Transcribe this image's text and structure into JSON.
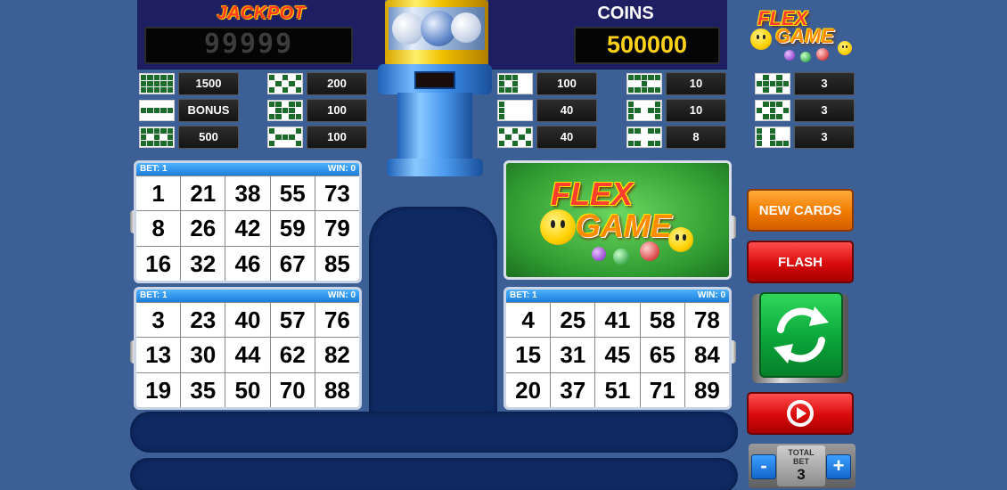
{
  "jackpot": {
    "label": "JACKPOT",
    "value": "99999"
  },
  "coins": {
    "label": "COINS",
    "value": "500000"
  },
  "logo": {
    "line1": "FLEX",
    "line2": "GAME"
  },
  "paytable": [
    {
      "value": "1500",
      "pattern": [
        1,
        1,
        1,
        1,
        1,
        1,
        1,
        1,
        1,
        1,
        1,
        1,
        1,
        1,
        1
      ]
    },
    {
      "value": "BONUS",
      "pattern": [
        0,
        0,
        0,
        0,
        0,
        1,
        1,
        1,
        1,
        1,
        0,
        0,
        0,
        0,
        0
      ]
    },
    {
      "value": "500",
      "pattern": [
        1,
        1,
        1,
        1,
        1,
        1,
        0,
        1,
        0,
        1,
        1,
        1,
        1,
        1,
        1
      ]
    },
    {
      "value": "200",
      "pattern": [
        1,
        0,
        1,
        0,
        1,
        0,
        1,
        0,
        1,
        0,
        1,
        0,
        1,
        0,
        1
      ]
    },
    {
      "value": "100",
      "pattern": [
        1,
        1,
        0,
        1,
        1,
        0,
        1,
        1,
        1,
        0,
        1,
        1,
        0,
        1,
        1
      ]
    },
    {
      "value": "100",
      "pattern": [
        1,
        0,
        0,
        0,
        1,
        0,
        1,
        1,
        1,
        0,
        1,
        0,
        0,
        0,
        1
      ]
    },
    {
      "value": "100",
      "pattern": [
        1,
        1,
        1,
        0,
        0,
        1,
        0,
        1,
        0,
        0,
        1,
        1,
        1,
        0,
        0
      ]
    },
    {
      "value": "40",
      "pattern": [
        1,
        0,
        0,
        0,
        0,
        1,
        0,
        0,
        0,
        0,
        1,
        0,
        0,
        0,
        0
      ]
    },
    {
      "value": "40",
      "pattern": [
        1,
        0,
        1,
        0,
        1,
        0,
        1,
        0,
        1,
        0,
        1,
        0,
        1,
        0,
        1
      ]
    },
    {
      "value": "10",
      "pattern": [
        1,
        1,
        1,
        1,
        1,
        0,
        0,
        1,
        0,
        0,
        1,
        1,
        1,
        1,
        1
      ]
    },
    {
      "value": "10",
      "pattern": [
        1,
        0,
        0,
        0,
        1,
        1,
        1,
        0,
        1,
        1,
        1,
        0,
        0,
        0,
        1
      ]
    },
    {
      "value": "8",
      "pattern": [
        1,
        1,
        0,
        1,
        1,
        0,
        0,
        0,
        0,
        0,
        1,
        1,
        0,
        1,
        1
      ]
    },
    {
      "value": "3",
      "pattern": [
        0,
        1,
        0,
        1,
        0,
        1,
        1,
        1,
        1,
        1,
        0,
        1,
        0,
        1,
        0
      ]
    },
    {
      "value": "3",
      "pattern": [
        0,
        1,
        1,
        1,
        0,
        1,
        0,
        1,
        0,
        1,
        0,
        1,
        1,
        1,
        0
      ]
    },
    {
      "value": "3",
      "pattern": [
        1,
        0,
        1,
        0,
        0,
        1,
        0,
        1,
        0,
        0,
        1,
        0,
        1,
        1,
        1
      ]
    }
  ],
  "cards": [
    {
      "bet": "BET: 1",
      "win": "WIN: 0",
      "numbers": [
        "1",
        "21",
        "38",
        "55",
        "73",
        "8",
        "26",
        "42",
        "59",
        "79",
        "16",
        "32",
        "46",
        "67",
        "85"
      ]
    },
    {
      "bet": "BET: 1",
      "win": "WIN: 0",
      "numbers": [
        "3",
        "23",
        "40",
        "57",
        "76",
        "13",
        "30",
        "44",
        "62",
        "82",
        "19",
        "35",
        "50",
        "70",
        "88"
      ]
    },
    {
      "bet": "BET: 1",
      "win": "WIN: 0",
      "numbers": [
        "4",
        "25",
        "41",
        "58",
        "78",
        "15",
        "31",
        "45",
        "65",
        "84",
        "20",
        "37",
        "51",
        "71",
        "89"
      ]
    }
  ],
  "buttons": {
    "new_cards": "NEW CARDS",
    "flash": "FLASH",
    "total_bet_label_1": "TOTAL",
    "total_bet_label_2": "BET",
    "total_bet_value": "3",
    "minus": "-",
    "plus": "+"
  },
  "colors": {
    "background": "#3c5f95",
    "pattern_on": "#1b6b2a",
    "card_header": "#1a7ed8",
    "new_cards": "#f07a00",
    "flash": "#d80a0a",
    "play": "#0aa53a"
  }
}
